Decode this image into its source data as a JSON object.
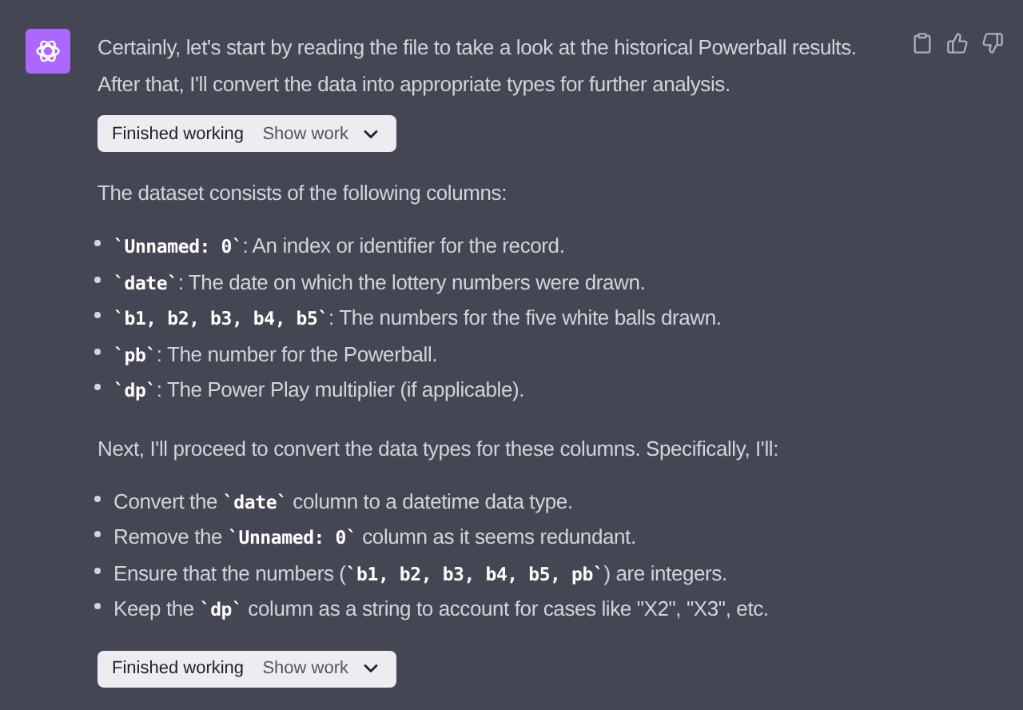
{
  "message": {
    "paragraphs": [
      {
        "kind": "text",
        "text": "Certainly, let's start by reading the file to take a look at the historical Powerball results. After that, I'll convert the data into appropriate types for further analysis."
      },
      {
        "kind": "work",
        "status": "Finished working",
        "action": "Show work"
      },
      {
        "kind": "text",
        "text": "The dataset consists of the following columns:"
      },
      {
        "kind": "list",
        "items": [
          [
            {
              "kind": "code",
              "text": "`Unnamed: 0`"
            },
            {
              "kind": "text",
              "text": ": An index or identifier for the record."
            }
          ],
          [
            {
              "kind": "code",
              "text": "`date`"
            },
            {
              "kind": "text",
              "text": ": The date on which the lottery numbers were drawn."
            }
          ],
          [
            {
              "kind": "code",
              "text": "`b1, b2, b3, b4, b5`"
            },
            {
              "kind": "text",
              "text": ": The numbers for the five white balls drawn."
            }
          ],
          [
            {
              "kind": "code",
              "text": "`pb`"
            },
            {
              "kind": "text",
              "text": ": The number for the Powerball."
            }
          ],
          [
            {
              "kind": "code",
              "text": "`dp`"
            },
            {
              "kind": "text",
              "text": ": The Power Play multiplier (if applicable)."
            }
          ]
        ]
      },
      {
        "kind": "text",
        "text": "Next, I'll proceed to convert the data types for these columns. Specifically, I'll:"
      },
      {
        "kind": "list",
        "items": [
          [
            {
              "kind": "text",
              "text": "Convert the "
            },
            {
              "kind": "code",
              "text": "`date`"
            },
            {
              "kind": "text",
              "text": " column to a datetime data type."
            }
          ],
          [
            {
              "kind": "text",
              "text": "Remove the "
            },
            {
              "kind": "code",
              "text": "`Unnamed: 0`"
            },
            {
              "kind": "text",
              "text": " column as it seems redundant."
            }
          ],
          [
            {
              "kind": "text",
              "text": "Ensure that the numbers ("
            },
            {
              "kind": "code",
              "text": "`b1, b2, b3, b4, b5, pb`"
            },
            {
              "kind": "text",
              "text": ") are integers."
            }
          ],
          [
            {
              "kind": "text",
              "text": "Keep the "
            },
            {
              "kind": "code",
              "text": "`dp`"
            },
            {
              "kind": "text",
              "text": " column as a string to account for cases like \"X2\", \"X3\", etc."
            }
          ]
        ]
      },
      {
        "kind": "work",
        "status": "Finished working",
        "action": "Show work"
      }
    ]
  }
}
